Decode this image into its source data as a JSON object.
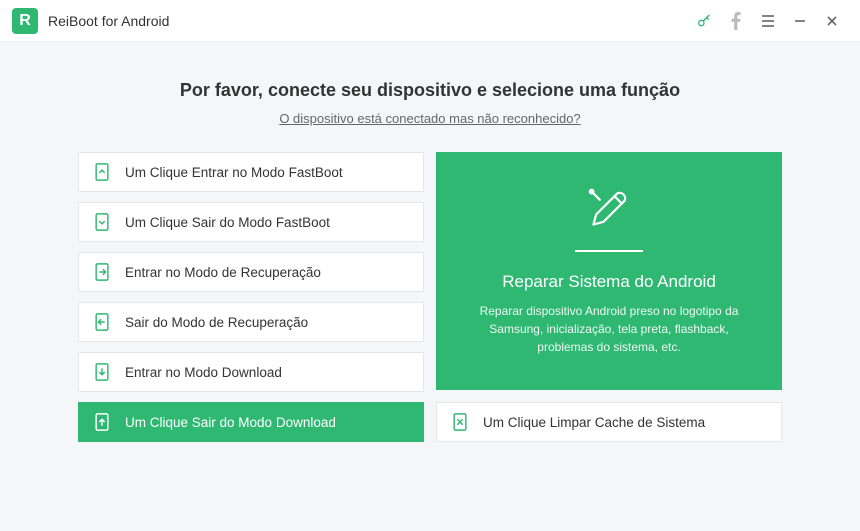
{
  "titlebar": {
    "app_name": "ReiBoot for Android",
    "logo_letter": "R"
  },
  "main": {
    "headline": "Por favor, conecte seu dispositivo e selecione uma função",
    "sublink": "O dispositivo está conectado mas não reconhecido?"
  },
  "options": {
    "enter_fastboot": "Um Clique Entrar no Modo FastBoot",
    "exit_fastboot": "Um Clique Sair do Modo FastBoot",
    "enter_recovery": "Entrar no Modo de Recuperação",
    "exit_recovery": "Sair do Modo de Recuperação",
    "enter_download": "Entrar no Modo Download",
    "exit_download": "Um Clique Sair do Modo Download",
    "clear_cache": "Um Clique Limpar Cache de Sistema"
  },
  "repair": {
    "title": "Reparar Sistema do Android",
    "desc": "Reparar dispositivo Android preso no logotipo da Samsung, inicialização, tela preta, flashback, problemas do sistema, etc."
  },
  "colors": {
    "brand_green": "#2eb872",
    "bg": "#f5f6f7"
  }
}
